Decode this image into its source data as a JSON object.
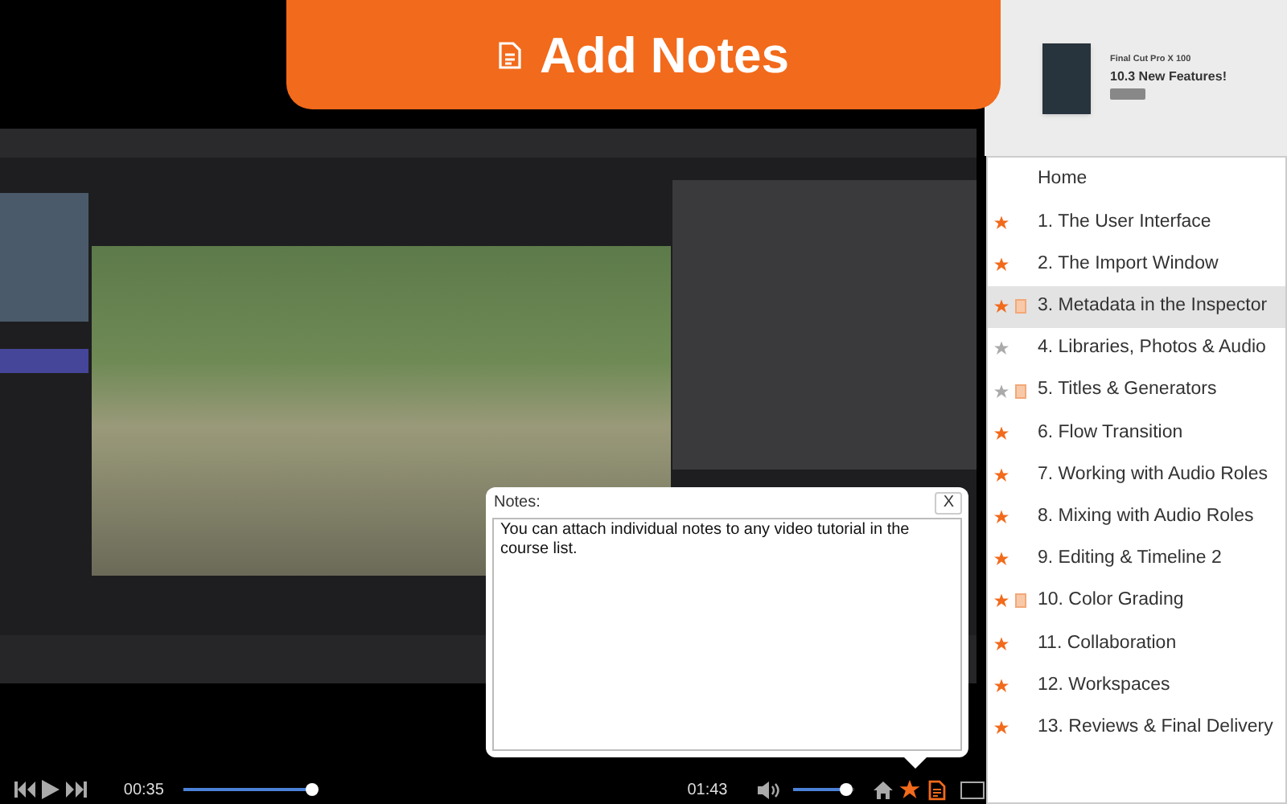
{
  "header": {
    "title": "Add Notes"
  },
  "banner": {
    "subtitle": "Final Cut Pro X 100",
    "title": "10.3 New Features!"
  },
  "notes": {
    "label": "Notes:",
    "close": "X",
    "text": "You can attach individual notes to any video tutorial in the course list."
  },
  "player": {
    "elapsed": "00:35",
    "level": 0.27,
    "duration": "01:43",
    "volume": {
      "level": 0.95
    },
    "favorite": true,
    "notes_open": true
  },
  "lessons": [
    {
      "kind": "home",
      "title": "Home",
      "selected": false
    },
    {
      "kind": "lesson",
      "title": "1. The User Interface",
      "favorite": true,
      "has_note": false,
      "selected": false
    },
    {
      "kind": "lesson",
      "title": "2. The Import Window",
      "favorite": true,
      "has_note": false,
      "selected": false
    },
    {
      "kind": "lesson",
      "title": "3. Metadata in the Inspector",
      "favorite": true,
      "has_note": true,
      "selected": true
    },
    {
      "kind": "lesson",
      "title": "4. Libraries, Photos & Audio",
      "favorite": false,
      "has_note": false,
      "selected": false
    },
    {
      "kind": "lesson",
      "title": "5. Titles & Generators",
      "favorite": false,
      "has_note": true,
      "selected": false
    },
    {
      "kind": "lesson",
      "title": "6. Flow Transition",
      "favorite": true,
      "has_note": false,
      "selected": false
    },
    {
      "kind": "lesson",
      "title": "7. Working with Audio Roles",
      "favorite": true,
      "has_note": false,
      "selected": false
    },
    {
      "kind": "lesson",
      "title": "8. Mixing with Audio Roles",
      "favorite": true,
      "has_note": false,
      "selected": false
    },
    {
      "kind": "lesson",
      "title": "9. Editing & Timeline 2",
      "favorite": true,
      "has_note": false,
      "selected": false
    },
    {
      "kind": "lesson",
      "title": "10. Color Grading",
      "favorite": true,
      "has_note": true,
      "selected": false
    },
    {
      "kind": "lesson",
      "title": "11. Collaboration",
      "favorite": true,
      "has_note": false,
      "selected": false
    },
    {
      "kind": "lesson",
      "title": "12. Workspaces",
      "favorite": true,
      "has_note": false,
      "selected": false
    },
    {
      "kind": "lesson",
      "title": "13. Reviews & Final Delivery",
      "favorite": true,
      "has_note": false,
      "selected": false
    }
  ]
}
